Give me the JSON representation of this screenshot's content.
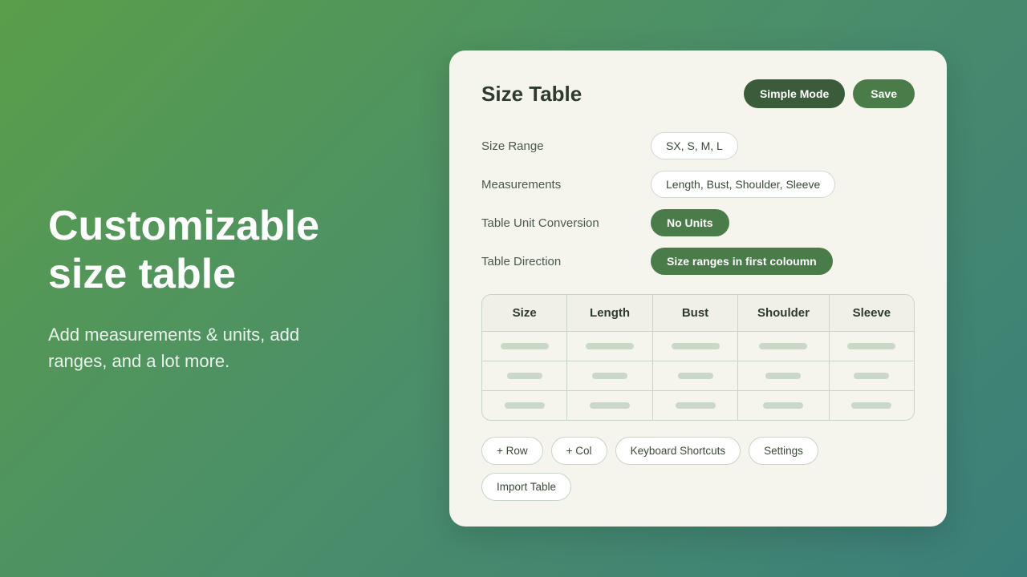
{
  "left": {
    "title": "Customizable size table",
    "description": "Add measurements & units, add ranges, and a lot more."
  },
  "card": {
    "title": "Size Table",
    "buttons": {
      "simple_mode": "Simple Mode",
      "save": "Save"
    },
    "config": {
      "size_range_label": "Size Range",
      "size_range_value": "SX, S, M, L",
      "measurements_label": "Measurements",
      "measurements_value": "Length, Bust, Shoulder, Sleeve",
      "unit_conversion_label": "Table Unit Conversion",
      "unit_conversion_value": "No Units",
      "direction_label": "Table Direction",
      "direction_value": "Size ranges in first coloumn"
    },
    "table": {
      "headers": [
        "Size",
        "Length",
        "Bust",
        "Shoulder",
        "Sleeve"
      ]
    },
    "bottom_buttons": [
      "+ Row",
      "+ Col",
      "Keyboard Shortcuts",
      "Settings",
      "Import Table"
    ]
  }
}
